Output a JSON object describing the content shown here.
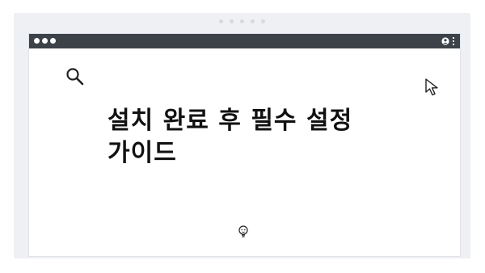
{
  "page": {
    "headline_line1": "설치 완료 후 필수 설정",
    "headline_line2": "가이드"
  },
  "icons": {
    "search": "search-icon",
    "cursor": "cursor-arrow-icon",
    "bulb": "lightbulb-icon",
    "user": "user-icon",
    "menu": "kebab-menu-icon"
  },
  "colors": {
    "titlebar": "#3d4249",
    "background": "#eef0f3",
    "text": "#111111"
  }
}
